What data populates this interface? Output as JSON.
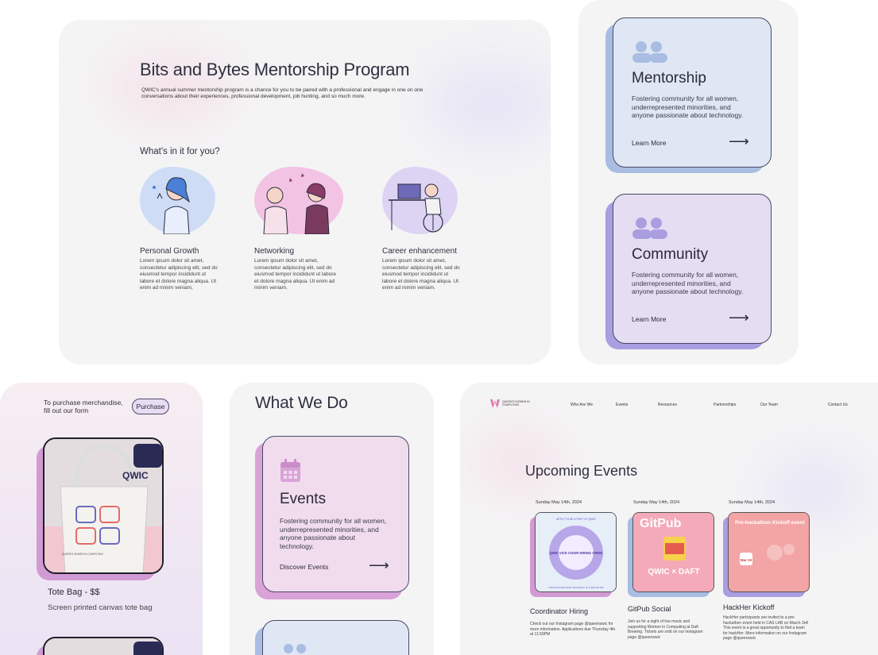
{
  "program": {
    "title": "Bits and Bytes Mentorship Program",
    "description": "QWIC's annual summer mentorship program is a chance for you to be paired with a professional and engage in one on one conversations about their experiences, professional development, job hunting, and so much more.",
    "whats_in_it": "What's in it for you?",
    "benefits": [
      {
        "title": "Personal Growth",
        "text": "Lorem ipsum dolor sit amet, consectetur adipiscing elit, sed do eiusmod tempor incididunt ut labore et dolore magna aliqua. Ut enim ad minim veniam,"
      },
      {
        "title": "Networking",
        "text": "Lorem ipsum dolor sit amet, consectetur adipiscing elit, sed do eiusmod tempor incididunt ut labore et dolore magna aliqua. Ut enim ad minim veniam."
      },
      {
        "title": "Career enhancement",
        "text": "Lorem ipsum dolor sit amet, consectetur adipiscing elit, sed do eiusmod tempor incididunt ut labore et dolore magna aliqua. Ut enim ad minim veniam."
      }
    ]
  },
  "cards": [
    {
      "title": "Mentorship",
      "text": "Fostering community for all women, underrepresented minorities, and anyone passionate about technology.",
      "link": "Learn More",
      "icon": "people-icon",
      "color": "#dfe7f4",
      "shadow": "#a9bde3"
    },
    {
      "title": "Community",
      "text": "Fostering community for all women, underrepresented minorities, and anyone passionate about technology.",
      "link": "Learn More",
      "icon": "people-icon",
      "color": "#e5def3",
      "shadow": "#a99ee0"
    }
  ],
  "merch": {
    "note": "To purchase merchandise, fill out our form",
    "button": "Purchase",
    "item_name": "Tote Bag - $$",
    "item_desc": "Screen printed canvas tote bag",
    "tote_text": "QWIC",
    "tote_caption": "QUEEN'S WOMEN IN COMPUTING"
  },
  "what_we_do": {
    "title": "What We Do",
    "events_card": {
      "title": "Events",
      "text": "Fostering community for all women, underrepresented minorities, and anyone passionate about technology.",
      "link": "Discover Events",
      "icon": "calendar-icon",
      "color": "#f1dcee",
      "shadow": "#d9a3d8"
    }
  },
  "events_page": {
    "logo_text": "QUEEN'S WOMEN IN COMPUTING",
    "nav": [
      "Who Are We",
      "Events",
      "Resources",
      "Partnerships",
      "Our Team",
      "Contact Us"
    ],
    "title": "Upcoming Events",
    "events": [
      {
        "date": "Sunday May 14th, 2024",
        "title": "Coordinator Hiring",
        "text": "Check out our Instagram page @queenswic for more information. Applications due Thursday 4th at 11:59PM",
        "poster": "QWIC VICE CHAIR HIRING OPEN!",
        "poster_top": "APPLY TO BE A PART OF QWIC",
        "poster_bottom": "APPLICATIONS DUE THURSDAY 4TH @11:59 PM",
        "shadow": "#d29ad3"
      },
      {
        "date": "Sunday May 14th, 2024",
        "title": "GitPub Social",
        "text": "Join us for a night of live music and supporting Women in Computing at Daft Brewing. Tickets are sold on our instagram page @queenswic",
        "poster": "GitPub",
        "poster_sub": "QWIC × DAFT",
        "shadow": "#a9bde3"
      },
      {
        "date": "Sunday May 14th, 2024",
        "title": "HackHer Kickoff",
        "text": "HackHer participants are invited to a pre-hackathon event held in CAS LAB on March 3rd! This event is a great opportunity to find a team for hackHer. More information on our Instagram page @queenswic",
        "poster": "Pre-hackathon Kickoff event",
        "poster_date": "Mar 03",
        "shadow": "#a99ee0"
      }
    ]
  }
}
